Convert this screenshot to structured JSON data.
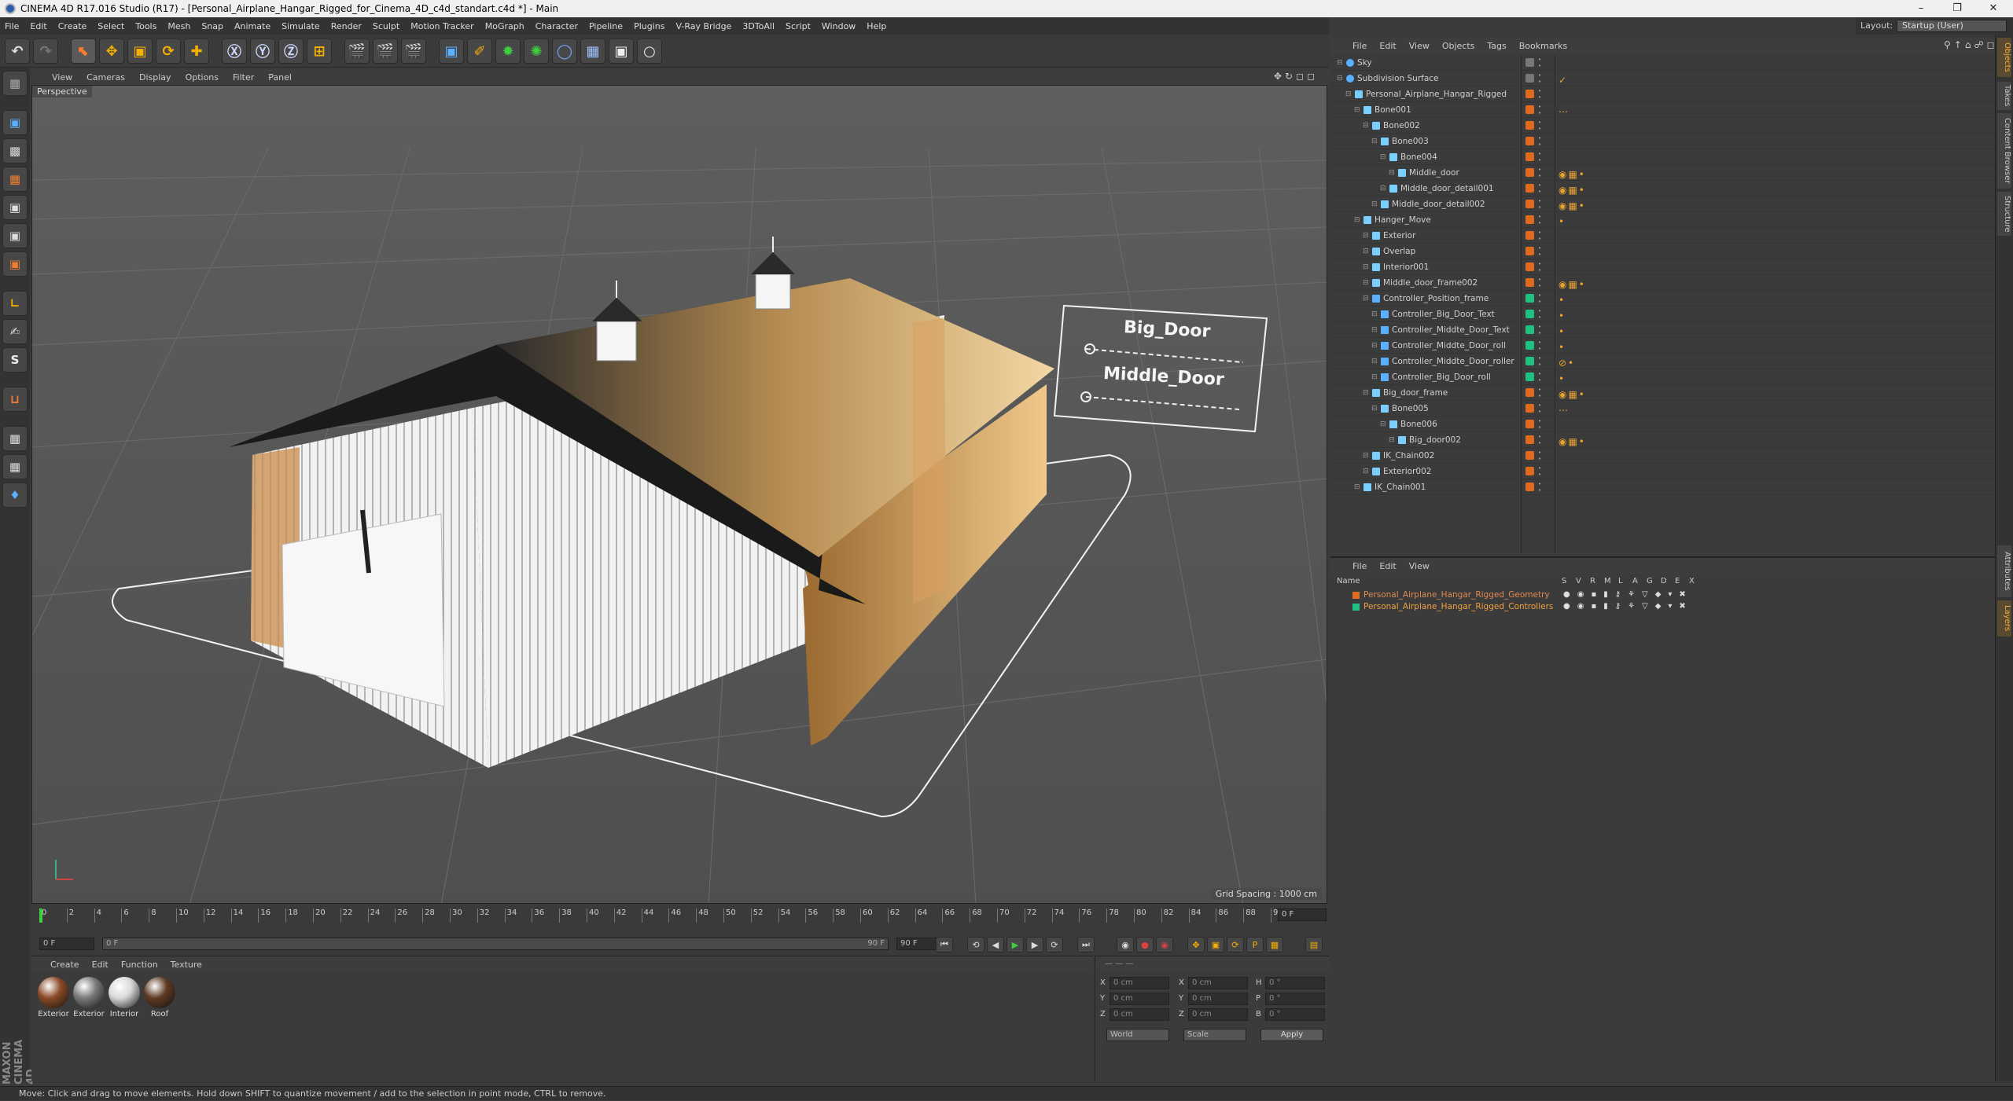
{
  "window": {
    "title": "CINEMA 4D R17.016 Studio (R17) - [Personal_Airplane_Hangar_Rigged_for_Cinema_4D_c4d_standart.c4d *] - Main"
  },
  "menubar": [
    "File",
    "Edit",
    "Create",
    "Select",
    "Tools",
    "Mesh",
    "Snap",
    "Animate",
    "Simulate",
    "Render",
    "Sculpt",
    "Motion Tracker",
    "MoGraph",
    "Character",
    "Pipeline",
    "Plugins",
    "V-Ray Bridge",
    "3DToAll",
    "Script",
    "Window",
    "Help"
  ],
  "layout": {
    "label": "Layout:",
    "value": "Startup (User)"
  },
  "viewport": {
    "menu": [
      "View",
      "Cameras",
      "Display",
      "Options",
      "Filter",
      "Panel"
    ],
    "label": "Perspective",
    "grid_spacing": "Grid Spacing : 1000 cm",
    "controller_labels": [
      "Big_Door",
      "Middle_Door"
    ]
  },
  "timeline": {
    "ticks": [
      "0",
      "2",
      "4",
      "6",
      "8",
      "10",
      "12",
      "14",
      "16",
      "18",
      "20",
      "22",
      "24",
      "26",
      "28",
      "30",
      "32",
      "34",
      "36",
      "38",
      "40",
      "42",
      "44",
      "46",
      "48",
      "50",
      "52",
      "54",
      "56",
      "58",
      "60",
      "62",
      "64",
      "66",
      "68",
      "70",
      "72",
      "74",
      "76",
      "78",
      "80",
      "82",
      "84",
      "86",
      "88",
      "90"
    ],
    "current_frame": "0 F",
    "start": "0 F",
    "min": "0 F",
    "max": "90 F",
    "end": "90 F"
  },
  "materials": {
    "menu": [
      "Create",
      "Edit",
      "Function",
      "Texture"
    ],
    "items": [
      {
        "name": "Exterior",
        "color": "#8a4a26"
      },
      {
        "name": "Exterior",
        "color": "#7a7a7a"
      },
      {
        "name": "Interior",
        "color": "#d8d8d8"
      },
      {
        "name": "Roof",
        "color": "#5e3a22"
      }
    ]
  },
  "coords": {
    "rows": [
      {
        "a": "X",
        "av": "0 cm",
        "b": "X",
        "bv": "0 cm",
        "c": "H",
        "cv": "0 °"
      },
      {
        "a": "Y",
        "av": "0 cm",
        "b": "Y",
        "bv": "0 cm",
        "c": "P",
        "cv": "0 °"
      },
      {
        "a": "Z",
        "av": "0 cm",
        "b": "Z",
        "bv": "0 cm",
        "c": "B",
        "cv": "0 °"
      }
    ],
    "mode1": "World",
    "mode2": "Scale",
    "apply": "Apply"
  },
  "objects": {
    "menu": [
      "File",
      "Edit",
      "View",
      "Objects",
      "Tags",
      "Bookmarks"
    ],
    "rows": [
      {
        "name": "Sky",
        "depth": 0,
        "tag": "#777777",
        "tags": ""
      },
      {
        "name": "Subdivision Surface",
        "depth": 0,
        "tag": "#777777",
        "tags": "✓"
      },
      {
        "name": "Personal_Airplane_Hangar_Rigged",
        "depth": 1,
        "tag": "#e06a20",
        "tags": ""
      },
      {
        "name": "Bone001",
        "depth": 2,
        "tag": "#e06a20",
        "tags": "⋯"
      },
      {
        "name": "Bone002",
        "depth": 3,
        "tag": "#e06a20",
        "tags": ""
      },
      {
        "name": "Bone003",
        "depth": 4,
        "tag": "#e06a20",
        "tags": ""
      },
      {
        "name": "Bone004",
        "depth": 5,
        "tag": "#e06a20",
        "tags": ""
      },
      {
        "name": "Middle_door",
        "depth": 6,
        "tag": "#e06a20",
        "tags": "◉▦•"
      },
      {
        "name": "Middle_door_detail001",
        "depth": 5,
        "tag": "#e06a20",
        "tags": "◉▦•"
      },
      {
        "name": "Middle_door_detail002",
        "depth": 4,
        "tag": "#e06a20",
        "tags": "◉▦•"
      },
      {
        "name": "Hanger_Move",
        "depth": 2,
        "tag": "#e06a20",
        "tags": "•"
      },
      {
        "name": "Exterior",
        "depth": 3,
        "tag": "#e06a20",
        "tags": ""
      },
      {
        "name": "Overlap",
        "depth": 3,
        "tag": "#e06a20",
        "tags": ""
      },
      {
        "name": "Interior001",
        "depth": 3,
        "tag": "#e06a20",
        "tags": ""
      },
      {
        "name": "Middle_door_frame002",
        "depth": 3,
        "tag": "#e06a20",
        "tags": "◉▦•"
      },
      {
        "name": "Controller_Position_frame",
        "depth": 3,
        "tag": "#20c080",
        "tags": "•"
      },
      {
        "name": "Controller_Big_Door_Text",
        "depth": 4,
        "tag": "#20c080",
        "tags": "•"
      },
      {
        "name": "Controller_Middte_Door_Text",
        "depth": 4,
        "tag": "#20c080",
        "tags": "•"
      },
      {
        "name": "Controller_Middte_Door_roll",
        "depth": 4,
        "tag": "#20c080",
        "tags": "•"
      },
      {
        "name": "Controller_Middte_Door_roller",
        "depth": 4,
        "tag": "#20c080",
        "tags": "⊘•"
      },
      {
        "name": "Controller_Big_Door_roll",
        "depth": 4,
        "tag": "#20c080",
        "tags": "•"
      },
      {
        "name": "Big_door_frame",
        "depth": 3,
        "tag": "#e06a20",
        "tags": "◉▦•"
      },
      {
        "name": "Bone005",
        "depth": 4,
        "tag": "#e06a20",
        "tags": "⋯"
      },
      {
        "name": "Bone006",
        "depth": 5,
        "tag": "#e06a20",
        "tags": ""
      },
      {
        "name": "Big_door002",
        "depth": 6,
        "tag": "#e06a20",
        "tags": "◉▦•"
      },
      {
        "name": "IK_Chain002",
        "depth": 3,
        "tag": "#e06a20",
        "tags": ""
      },
      {
        "name": "Exterior002",
        "depth": 3,
        "tag": "#e06a20",
        "tags": ""
      },
      {
        "name": "IK_Chain001",
        "depth": 2,
        "tag": "#e06a20",
        "tags": ""
      }
    ]
  },
  "layers": {
    "menu": [
      "File",
      "Edit",
      "View"
    ],
    "header_name": "Name",
    "header_cols": [
      "S",
      "V",
      "R",
      "M",
      "L",
      "A",
      "G",
      "D",
      "E",
      "X"
    ],
    "rows": [
      {
        "name": "Personal_Airplane_Hangar_Rigged_Geometry",
        "color": "#e06a20"
      },
      {
        "name": "Personal_Airplane_Hangar_Rigged_Controllers",
        "color": "#20c080"
      }
    ]
  },
  "right_tabs": [
    "Objects",
    "Takes",
    "Content Browser",
    "Structure",
    "Attributes",
    "Layers"
  ],
  "status": "Move: Click and drag to move elements. Hold down SHIFT to quantize movement / add to the selection in point mode, CTRL to remove.",
  "brand": "MAXON CINEMA 4D"
}
